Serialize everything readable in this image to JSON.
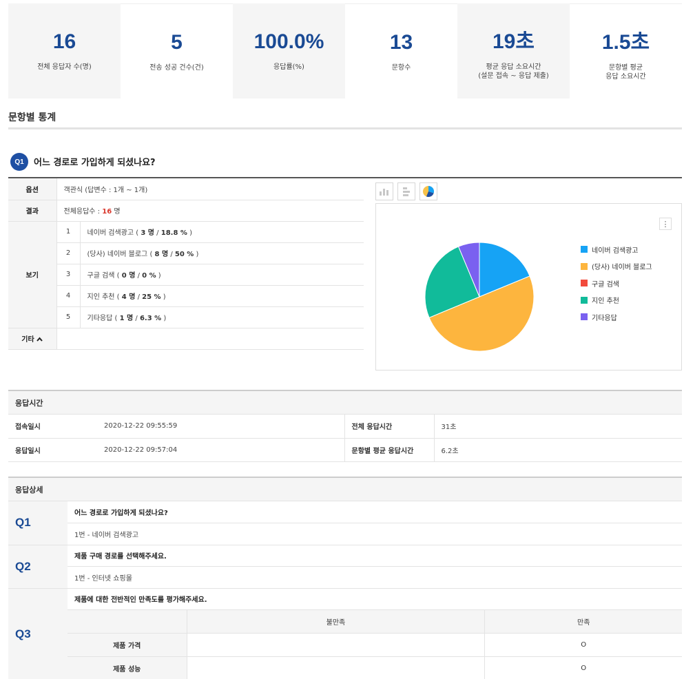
{
  "stats": [
    {
      "value": "16",
      "label1": "전체 응답자 수(명)",
      "label2": ""
    },
    {
      "value": "5",
      "label1": "전송 성공 건수(건)",
      "label2": ""
    },
    {
      "value": "100.0%",
      "label1": "응답률(%)",
      "label2": ""
    },
    {
      "value": "13",
      "label1": "문항수",
      "label2": ""
    },
    {
      "value": "19초",
      "label1": "평균 응답 소요시간",
      "label2": "(설문 접속 ~ 응답 제출)"
    },
    {
      "value": "1.5초",
      "label1": "문항별 평균",
      "label2": "응답 소요시간"
    }
  ],
  "section_title": "문항별 통계",
  "q1": {
    "badge": "Q1",
    "title": "어느 경로로 가입하게 되셨나요?",
    "option_label": "옵션",
    "option_value": "객관식 (답변수 : 1개 ~ 1개)",
    "result_label": "결과",
    "result_prefix": "전체응답수 : ",
    "result_count": "16",
    "result_suffix": " 명",
    "choices_label": "보기",
    "choices": [
      {
        "num": "1",
        "text": "네이버 검색광고",
        "open": " ( ",
        "count": "3 명",
        "sep": " / ",
        "pct": "18.8 %",
        "close": " )"
      },
      {
        "num": "2",
        "text": "(당사) 네이버 블로그",
        "open": " ( ",
        "count": "8 명",
        "sep": " / ",
        "pct": "50 %",
        "close": " )"
      },
      {
        "num": "3",
        "text": "구글 검색",
        "open": " ( ",
        "count": "0 명",
        "sep": " / ",
        "pct": "0 %",
        "close": " )"
      },
      {
        "num": "4",
        "text": "지인 추천",
        "open": " ( ",
        "count": "4 명",
        "sep": " / ",
        "pct": "25 %",
        "close": " )"
      },
      {
        "num": "5",
        "text": "기타응답",
        "open": " ( ",
        "count": "1 명",
        "sep": " / ",
        "pct": "6.3 %",
        "close": " )"
      }
    ],
    "other_label": "기타",
    "other_icon": "chevron-up-icon",
    "chart_buttons": [
      "bar-chart-icon",
      "horizontal-bar-chart-icon",
      "pie-chart-icon"
    ],
    "menu_icon": "more-vertical-icon"
  },
  "chart_data": {
    "type": "pie",
    "title": "",
    "legend_position": "right",
    "slices": [
      {
        "label": "네이버 검색광고",
        "value": 18.8,
        "color": "#16a3f5"
      },
      {
        "label": "(당사) 네이버 블로그",
        "value": 50,
        "color": "#fdb53e"
      },
      {
        "label": "구글 검색",
        "value": 0,
        "color": "#f24a3c"
      },
      {
        "label": "지인 추천",
        "value": 25,
        "color": "#11bb9a"
      },
      {
        "label": "기타응답",
        "value": 6.3,
        "color": "#7a61f0"
      }
    ]
  },
  "response_time": {
    "title": "응답시간",
    "rows": [
      {
        "k": "접속일시",
        "v": "2020-12-22 09:55:59",
        "k2": "전체 응답시간",
        "v2": "31초"
      },
      {
        "k": "응답일시",
        "v": "2020-12-22 09:57:04",
        "k2": "문항별 평균 응답시간",
        "v2": "6.2초"
      }
    ]
  },
  "detail": {
    "title": "응답상세",
    "items": [
      {
        "q": "Q1",
        "question": "어느 경로로 가입하게 되셨나요?",
        "answer": "1번 - 네이버 검색광고"
      },
      {
        "q": "Q2",
        "question": "제품 구매 경로를 선택해주세요.",
        "answer": "1번 - 인터넷 쇼핑몰"
      }
    ],
    "q3": {
      "q": "Q3",
      "question": "제품에 대한 전반적인 만족도를 평가해주세요.",
      "columns": [
        "불만족",
        "만족"
      ],
      "rows": [
        {
          "label": "제품 가격",
          "cells": [
            "",
            "O"
          ]
        },
        {
          "label": "제품 성능",
          "cells": [
            "",
            "O"
          ]
        }
      ]
    }
  },
  "colors": {
    "accent": "#1a4a94",
    "badge": "#1e4fa3",
    "highlight": "#d9362b"
  }
}
